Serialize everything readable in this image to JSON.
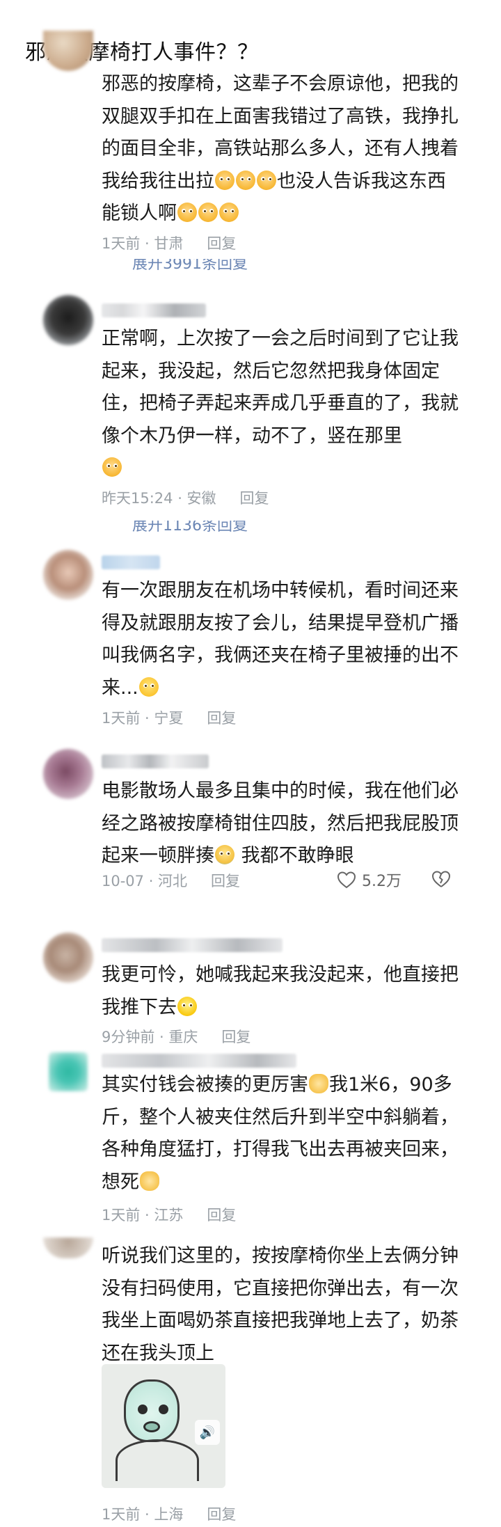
{
  "title": "邪恶按摩椅打人事件？？",
  "comments": [
    {
      "text_segments": [
        "邪恶的按摩椅，这辈子不会原谅他，把我的双腿双手扣在上面害我错过了高铁，我挣扎的面目全非，高铁站那么多人，还有人拽着我给我往出拉",
        "也没人告诉我这东西能锁人啊",
        ""
      ],
      "emoji": [
        "grimace-emoji",
        "grimace-emoji"
      ],
      "time": "1天前 · 甘肃",
      "reply": "回复"
    },
    {
      "text": "正常啊，上次按了一会之后时间到了它让我起来，我没起，然后它忽然把我身体固定住，把椅子弄起来弄成几乎垂直的了，我就像个木乃伊一样，动不了，竖在那里",
      "time": "昨天15:24 · 安徽",
      "reply": "回复"
    },
    {
      "text": "有一次跟朋友在机场中转候机，看时间还来得及就跟朋友按了会儿，结果提早登机广播叫我俩名字，我俩还夹在椅子里被捶的出不来...",
      "time": "1天前 · 宁夏",
      "reply": "回复"
    },
    {
      "text_before": "电影散场人最多且集中的时候，我在他们必经之路被按摩椅钳住四肢，然后把我屁股顶起来一顿胖揍",
      "text_after": " 我都不敢睁眼",
      "time": "10-07 · 河北",
      "reply": "回复",
      "likes": "5.2万"
    },
    {
      "text": "我更可怜，她喊我起来我没起来，他直接把我推下去",
      "time": "9分钟前 · 重庆",
      "reply": "回复"
    },
    {
      "text_a": "其实付钱会被揍的更厉害",
      "text_b": "我1米6，90多斤，整个人被夹住然后升到半空中斜躺着，各种角度猛打，打得我飞出去再被夹回来，想死",
      "time": "1天前 · 江苏",
      "reply": "回复"
    },
    {
      "text": "听说我们这里的，按按摩椅你坐上去俩分钟没有扫码使用，它直接把你弹出去，有一次我坐上面喝奶茶直接把我弹地上去了，奶茶还在我头顶上",
      "time": "1天前 · 上海",
      "reply": "回复"
    }
  ],
  "expand_1": "展开3991条回复",
  "expand_2": "展开1136条回复",
  "colors": {
    "text": "#1b1b1b",
    "meta": "#9aa0a6",
    "link": "#6b86b4"
  }
}
